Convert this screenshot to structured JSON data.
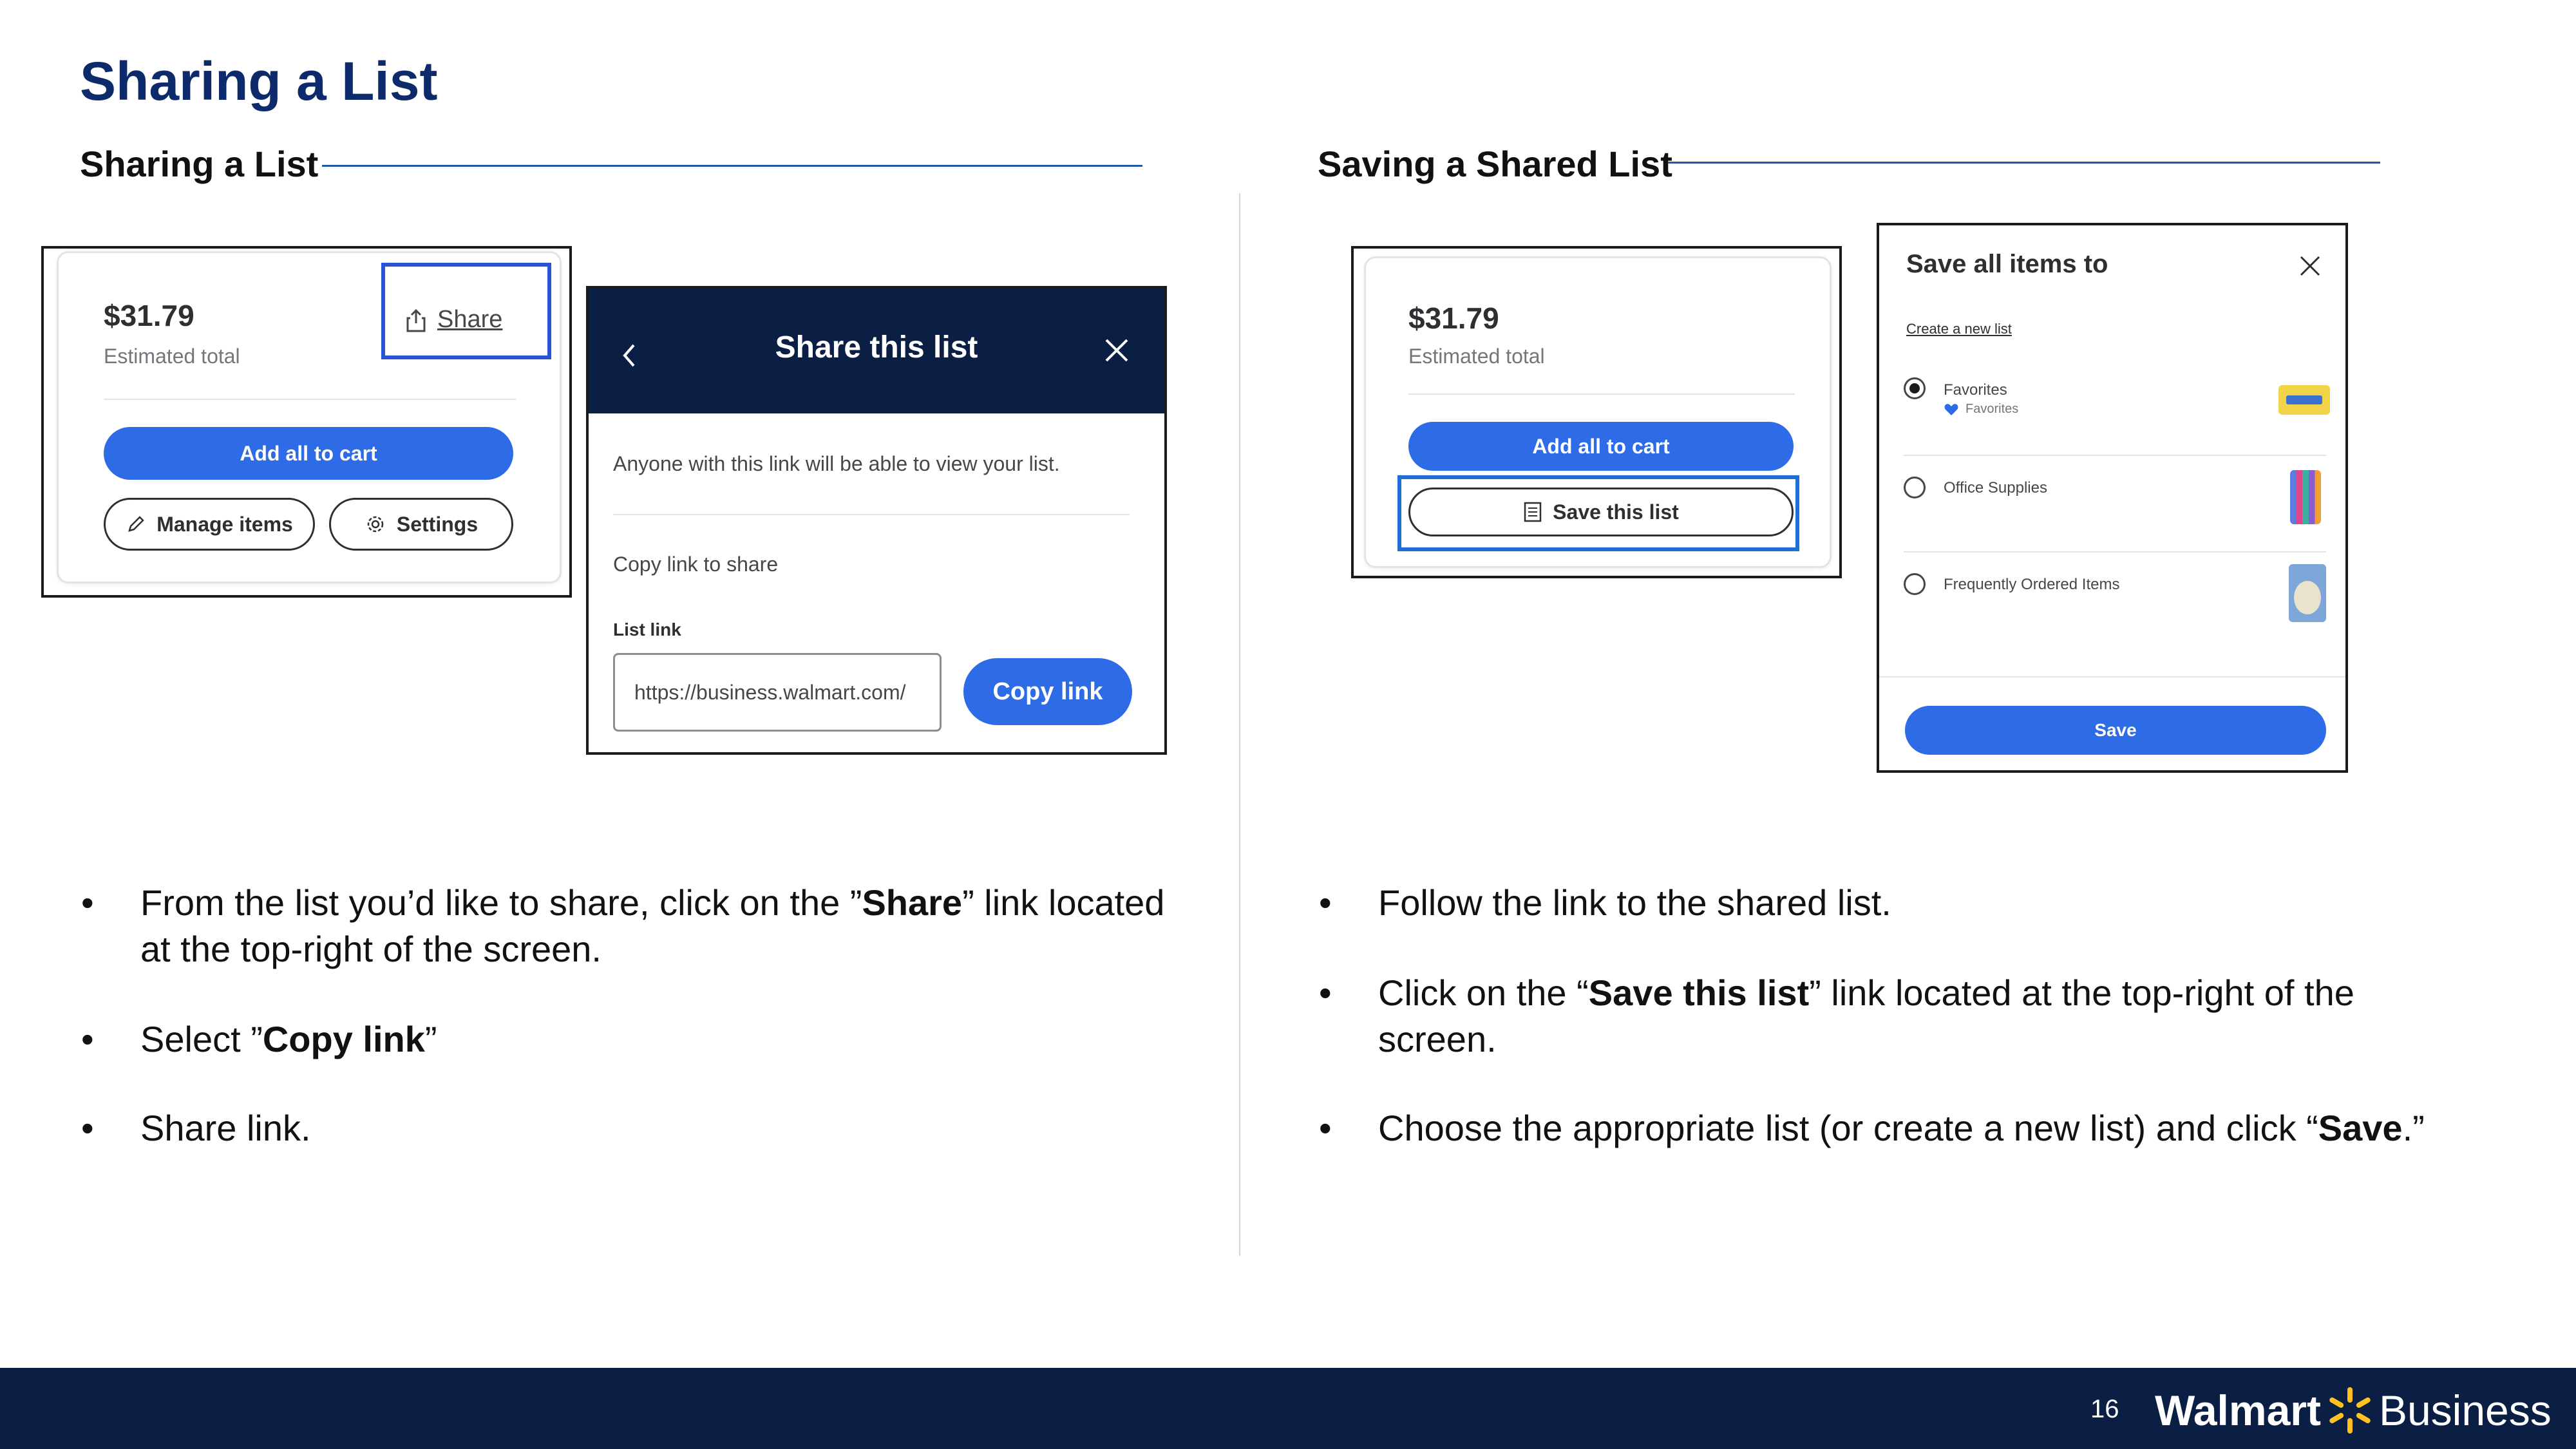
{
  "page_title": "Sharing a List",
  "left_section": {
    "heading": "Sharing a List",
    "card": {
      "price": "$31.79",
      "estimated_label": "Estimated total",
      "share_label": "Share",
      "add_all_label": "Add all to cart",
      "manage_label": "Manage items",
      "settings_label": "Settings"
    },
    "modal": {
      "title": "Share this list",
      "description": "Anyone with this link will be able to view your list.",
      "copy_prompt": "Copy link to share",
      "link_label": "List link",
      "link_value": "https://business.walmart.com/",
      "copy_button": "Copy link"
    },
    "bullets": [
      {
        "pre": "From the list you’d like to share, click on the ”",
        "bold": "Share",
        "post": "” link located",
        "line2": "at the top-right of the screen."
      },
      {
        "pre": "Select ”",
        "bold": "Copy link",
        "post": "”"
      },
      {
        "pre": "Share link.",
        "bold": "",
        "post": ""
      }
    ]
  },
  "right_section": {
    "heading": "Saving a Shared List",
    "card": {
      "price": "$31.79",
      "estimated_label": "Estimated total",
      "add_all_label": "Add all to cart",
      "save_list_label": "Save this list"
    },
    "save_modal": {
      "title": "Save all items to",
      "create_link": "Create a new list",
      "options": [
        {
          "label": "Favorites",
          "sublabel": "Favorites",
          "selected": true
        },
        {
          "label": "Office Supplies",
          "sublabel": "",
          "selected": false
        },
        {
          "label": "Frequently Ordered Items",
          "sublabel": "",
          "selected": false
        }
      ],
      "save_button": "Save"
    },
    "bullets": [
      {
        "pre": "Follow the link to the shared list.",
        "bold": "",
        "post": ""
      },
      {
        "pre": "Click on the “",
        "bold": "Save this list",
        "post": "” link located at the top-right of the",
        "line2": "screen."
      },
      {
        "pre": "Choose the appropriate list (or create a new list) and click “",
        "bold": "Save",
        "post": ".”"
      }
    ]
  },
  "footer": {
    "page_number": "16",
    "brand_bold": "Walmart",
    "brand_light": "Business"
  },
  "colors": {
    "navy": "#0b1f45",
    "blue": "#2e6be6",
    "spark": "#ffc220"
  }
}
